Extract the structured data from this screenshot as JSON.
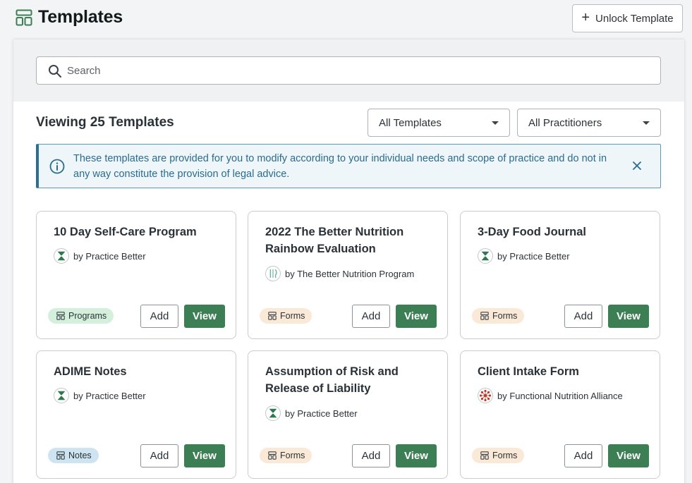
{
  "header": {
    "title": "Templates",
    "unlock_label": "Unlock Template"
  },
  "search": {
    "placeholder": "Search",
    "value": ""
  },
  "toolbar": {
    "viewing_label": "Viewing 25 Templates",
    "filter_type": "All Templates",
    "filter_practitioner": "All Practitioners"
  },
  "notice": {
    "text": "These templates are provided for you to modify according to your individual needs and scope of practice and do not in any way constitute the provision of legal advice."
  },
  "buttons": {
    "add": "Add",
    "view": "View"
  },
  "cards": [
    {
      "title": "10 Day Self-Care Program",
      "author": "by Practice Better",
      "author_icon": "practice-better-logo-icon",
      "badge": "Programs",
      "badge_kind": "programs"
    },
    {
      "title": "2022 The Better Nutrition Rainbow Evaluation",
      "author": "by The Better Nutrition Program",
      "author_icon": "better-nutrition-logo-icon",
      "badge": "Forms",
      "badge_kind": "forms"
    },
    {
      "title": "3-Day Food Journal",
      "author": "by Practice Better",
      "author_icon": "practice-better-logo-icon",
      "badge": "Forms",
      "badge_kind": "forms"
    },
    {
      "title": "ADIME Notes",
      "author": "by Practice Better",
      "author_icon": "practice-better-logo-icon",
      "badge": "Notes",
      "badge_kind": "notes"
    },
    {
      "title": "Assumption of Risk and Release of Liability",
      "author": "by Practice Better",
      "author_icon": "practice-better-logo-icon",
      "badge": "Forms",
      "badge_kind": "forms"
    },
    {
      "title": "Client Intake Form",
      "author": "by Functional Nutrition Alliance",
      "author_icon": "functional-nutrition-logo-icon",
      "badge": "Forms",
      "badge_kind": "forms"
    }
  ],
  "colors": {
    "brand_green": "#3d7f55",
    "notice_blue": "#2a6b8f",
    "programs_badge": "#d4f0dc",
    "forms_badge": "#fbe9d8",
    "notes_badge": "#cfe4f1"
  }
}
